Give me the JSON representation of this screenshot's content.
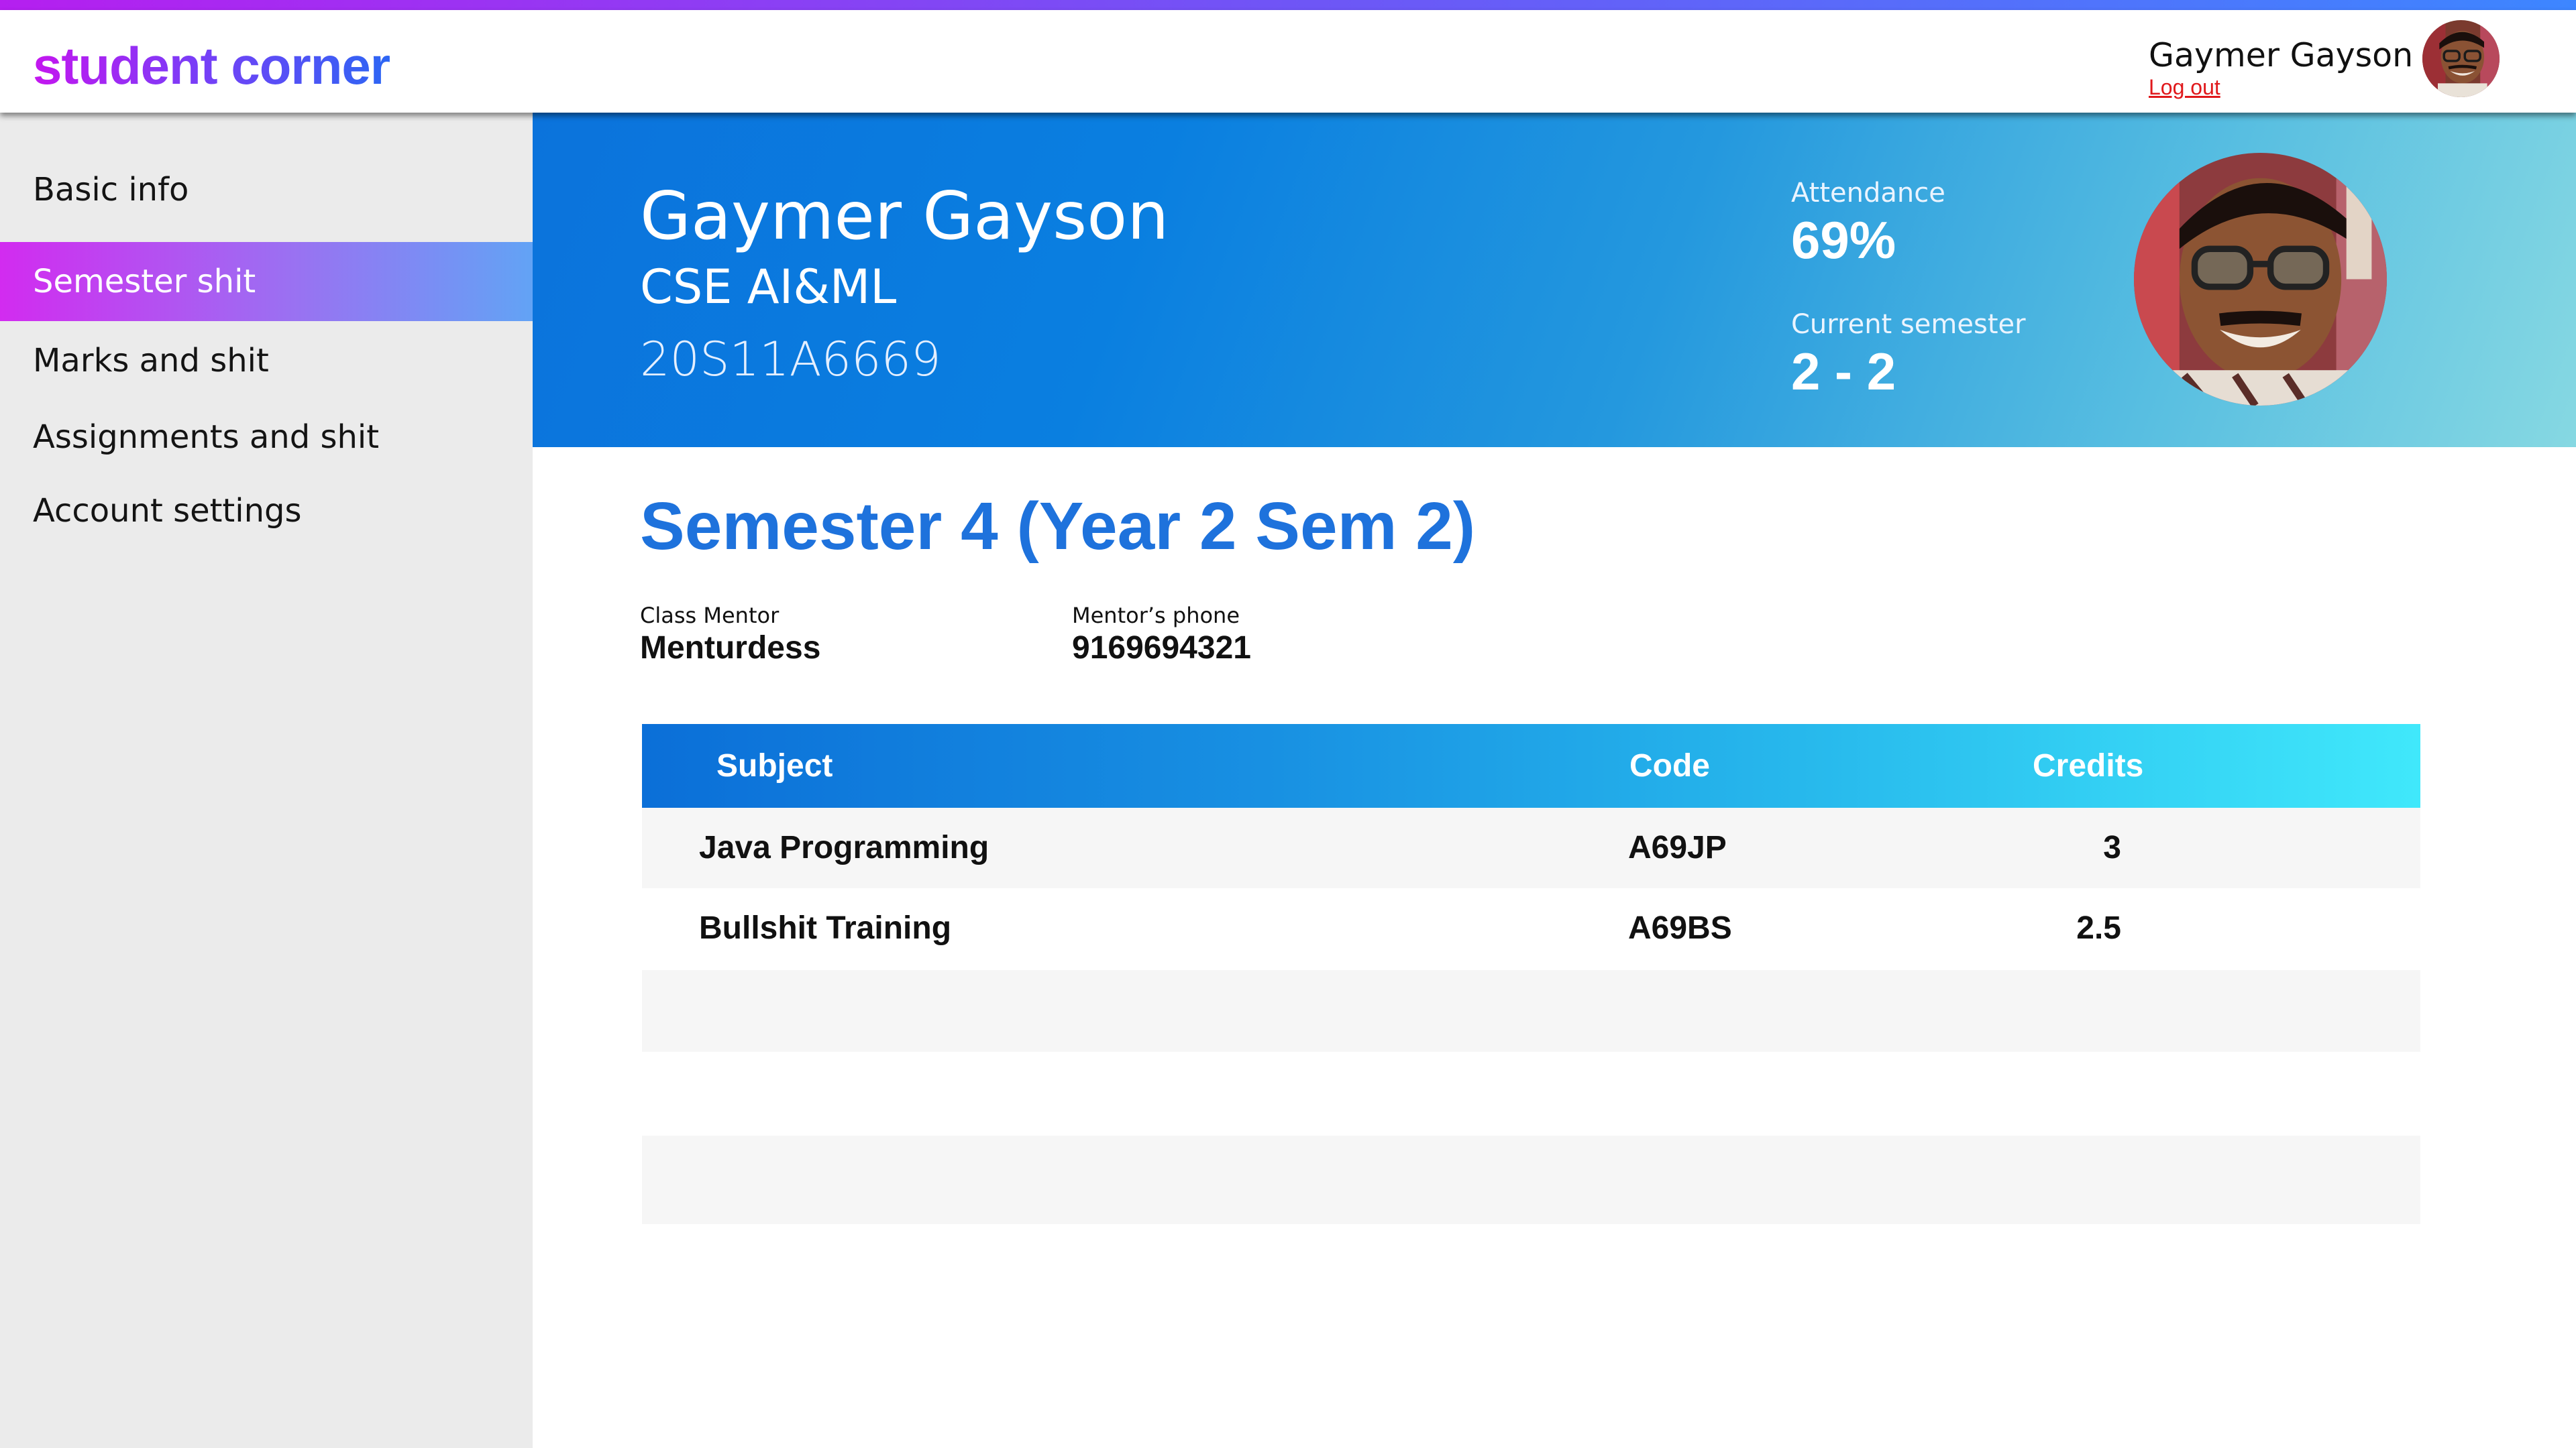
{
  "app": {
    "brand": "student corner"
  },
  "header": {
    "user_name": "Gaymer Gayson",
    "logout_label": "Log out"
  },
  "sidebar": {
    "items": [
      {
        "label": "Basic info",
        "active": false
      },
      {
        "label": "Semester shit",
        "active": true
      },
      {
        "label": "Marks and shit",
        "active": false
      },
      {
        "label": "Assignments and shit",
        "active": false
      },
      {
        "label": "Account settings",
        "active": false
      }
    ]
  },
  "profile": {
    "name": "Gaymer Gayson",
    "department": "CSE AI&ML",
    "roll_number": "20S11A6669",
    "attendance_label": "Attendance",
    "attendance_value": "69%",
    "semester_label": "Current semester",
    "semester_value": "2 - 2"
  },
  "semester": {
    "title": "Semester 4 (Year 2 Sem 2)",
    "mentor_label": "Class Mentor",
    "mentor_value": "Menturdess",
    "phone_label": "Mentor’s phone",
    "phone_value": "9169694321"
  },
  "subjects_table": {
    "headers": {
      "subject": "Subject",
      "code": "Code",
      "credits": "Credits"
    },
    "rows": [
      {
        "subject": "Java Programming",
        "code": "A69JP",
        "credits": "3"
      },
      {
        "subject": "Bullshit Training",
        "code": "A69BS",
        "credits": "2.5"
      }
    ],
    "empty_rows": 3
  },
  "colors": {
    "brand_gradient_start": "#c416ef",
    "brand_gradient_end": "#2c66f4",
    "banner_start": "#0b73dc",
    "banner_end": "#86d8e2",
    "title_blue": "#1e72dc",
    "logout_red": "#e0181b",
    "sidebar_bg": "#ebebeb"
  }
}
